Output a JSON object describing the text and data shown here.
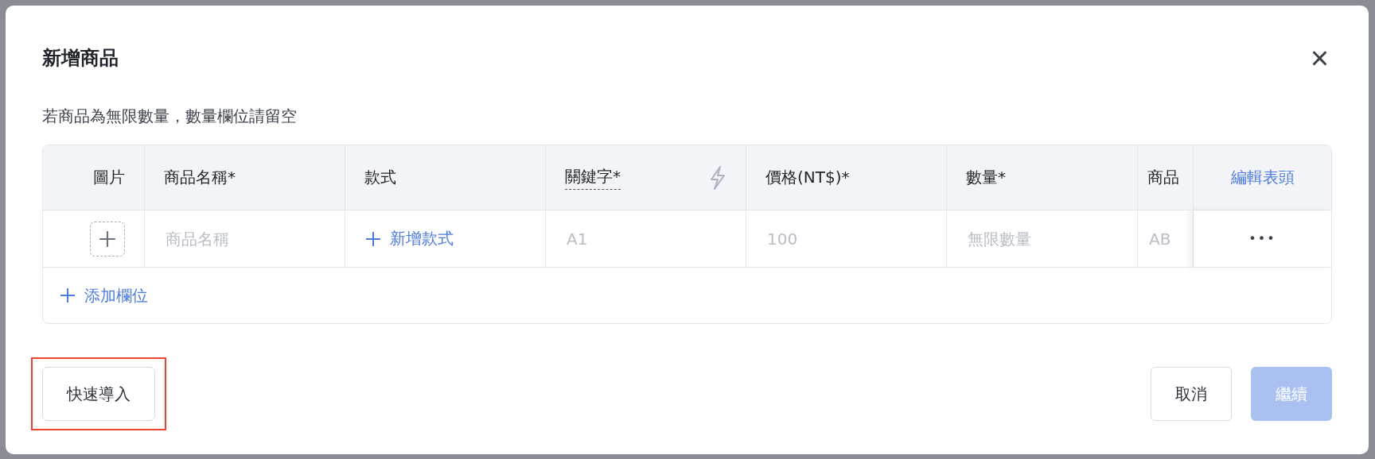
{
  "dialog": {
    "title": "新增商品",
    "close": "×"
  },
  "hint": "若商品為無限數量，數量欄位請留空",
  "table": {
    "columns": [
      {
        "label": "圖片",
        "kind": "plain"
      },
      {
        "label": "商品名稱*",
        "kind": "plain"
      },
      {
        "label": "款式",
        "kind": "plain"
      },
      {
        "label": "關鍵字*",
        "kind": "keyword"
      },
      {
        "label": "價格(NT$)*",
        "kind": "plain"
      },
      {
        "label": "數量*",
        "kind": "plain"
      },
      {
        "label": "商品",
        "kind": "plain"
      }
    ],
    "edit_header": "編輯表頭",
    "row": [
      {
        "kind": "image"
      },
      {
        "kind": "input",
        "placeholder": "商品名稱"
      },
      {
        "kind": "link",
        "label": "新增款式"
      },
      {
        "kind": "input",
        "placeholder": "A1"
      },
      {
        "kind": "input",
        "placeholder": "100"
      },
      {
        "kind": "input",
        "placeholder": "無限數量"
      },
      {
        "kind": "input",
        "placeholder": "AB"
      }
    ],
    "row_menu": "•••",
    "add_field": "添加欄位"
  },
  "footer": {
    "left": [
      {
        "label": "快速導入",
        "highlighted": true
      }
    ],
    "right": [
      {
        "label": "取消",
        "kind": "secondary",
        "disabled": false
      },
      {
        "label": "繼續",
        "kind": "primary",
        "disabled": true
      }
    ]
  }
}
